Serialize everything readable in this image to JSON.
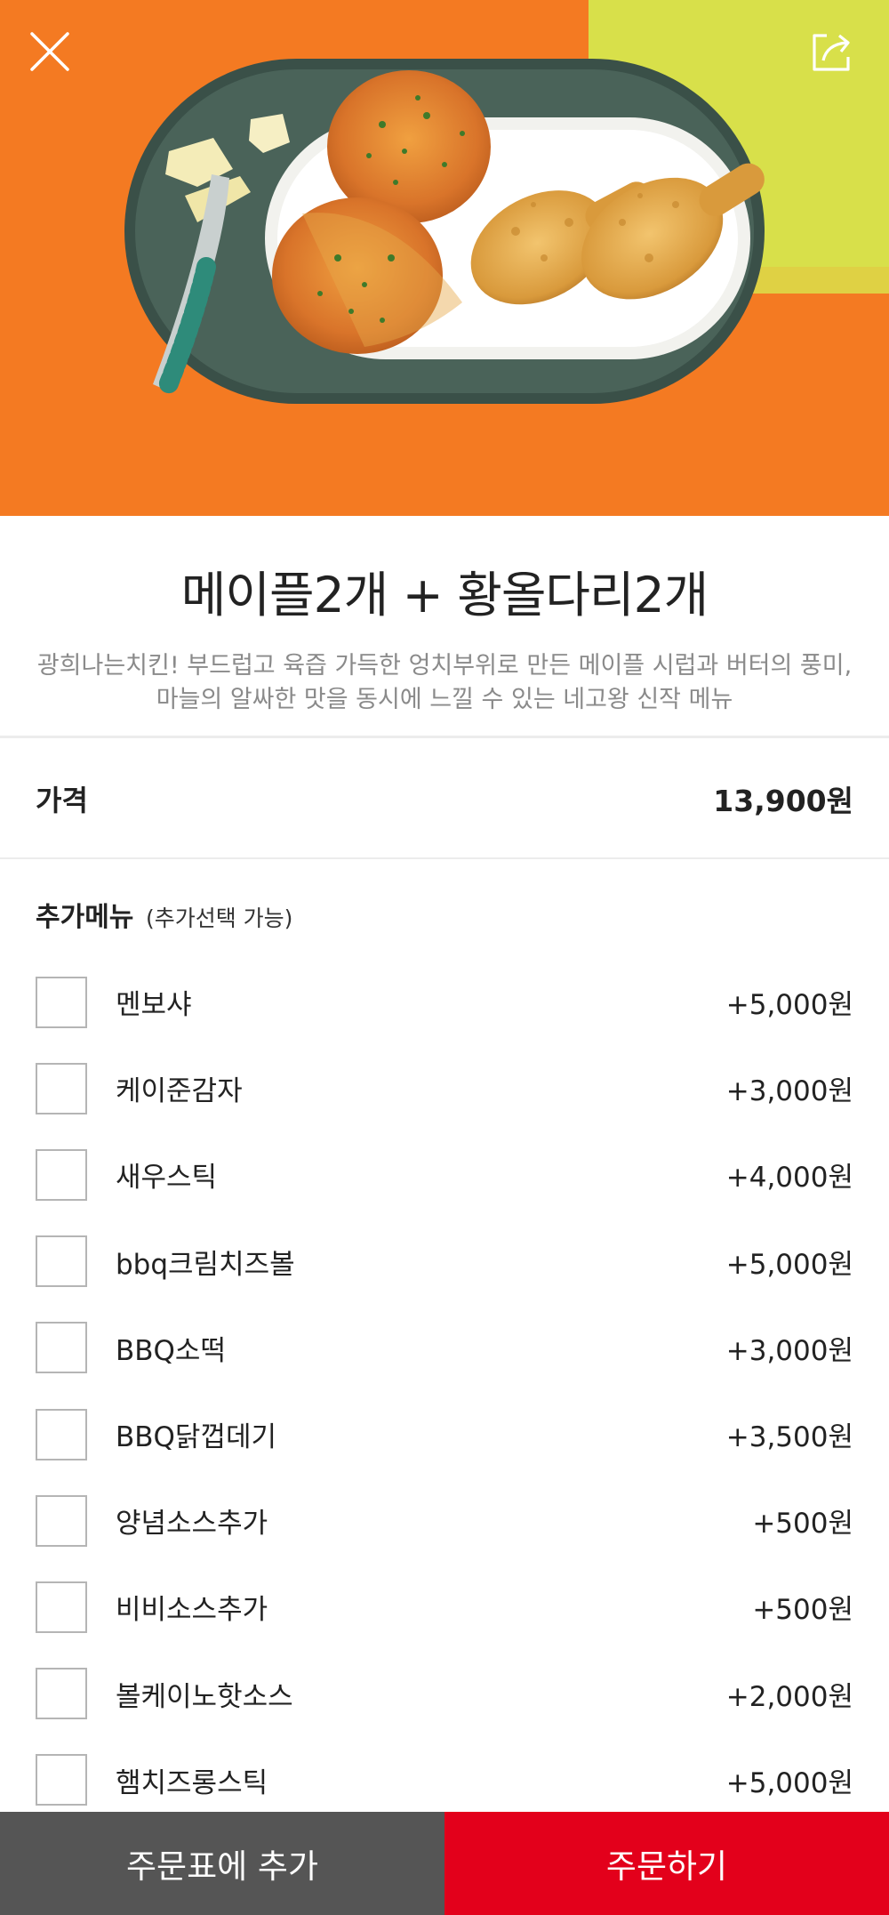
{
  "hero": {
    "close_icon": "close-icon",
    "share_icon": "share-icon",
    "image_subject": "chicken-dish-photo"
  },
  "product": {
    "title": "메이플2개 + 황올다리2개",
    "description_line1": "광희나는치킨! 부드럽고 육즙 가득한 엉치부위로 만든 메이플 시럽과 버터의 풍미,",
    "description_line2": "마늘의 알싸한 맛을 동시에 느낄 수 있는 네고왕 신작 메뉴"
  },
  "price": {
    "label": "가격",
    "value": "13,900원"
  },
  "extras": {
    "heading": "추가메뉴",
    "subheading": "(추가선택 가능)",
    "items": [
      {
        "name": "멘보샤",
        "price": "+5,000원"
      },
      {
        "name": "케이준감자",
        "price": "+3,000원"
      },
      {
        "name": "새우스틱",
        "price": "+4,000원"
      },
      {
        "name": "bbq크림치즈볼",
        "price": "+5,000원"
      },
      {
        "name": "BBQ소떡",
        "price": "+3,000원"
      },
      {
        "name": "BBQ닭껍데기",
        "price": "+3,500원"
      },
      {
        "name": "양념소스추가",
        "price": "+500원"
      },
      {
        "name": "비비소스추가",
        "price": "+500원"
      },
      {
        "name": "볼케이노핫소스",
        "price": "+2,000원"
      },
      {
        "name": "햄치즈롱스틱",
        "price": "+5,000원"
      }
    ]
  },
  "actions": {
    "add_to_cart": "주문표에 추가",
    "order_now": "주문하기"
  },
  "colors": {
    "accent": "#e3001b",
    "cart_button": "#555555",
    "hero_orange": "#f47a22",
    "hero_yellow": "#d8e04a"
  }
}
